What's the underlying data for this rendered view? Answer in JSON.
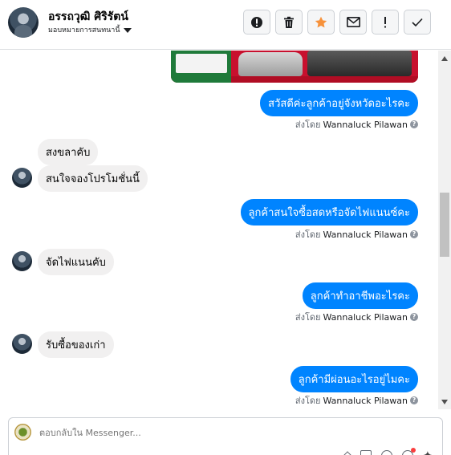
{
  "header": {
    "name": "อรรถวุฒิ ศิริรัตน์",
    "assign_label": "มอบหมายการสนทนานี้",
    "actions": [
      {
        "name": "alert-button",
        "icon": "exclamation-circle-icon"
      },
      {
        "name": "delete-button",
        "icon": "trash-icon"
      },
      {
        "name": "star-button",
        "icon": "star-icon"
      },
      {
        "name": "mark-unread-button",
        "icon": "envelope-icon"
      },
      {
        "name": "spam-button",
        "icon": "exclamation-icon"
      },
      {
        "name": "done-button",
        "icon": "check-icon"
      }
    ],
    "star_color": "#f7923b"
  },
  "messages": {
    "m1": "สวัสดีค่ะลูกค้าอยู่จังหวัดอะไรคะ",
    "m2": "สงขลาคับ",
    "m3": "สนใจจองโปรโมชั่นนี้",
    "m4": "ลูกค้าสนใจซื้อสดหรือจัดไฟแนนซ์คะ",
    "m5": "จัดไฟแนนคับ",
    "m6": "ลูกค้าทำอาชีพอะไรคะ",
    "m7": "รับซื้อของเก่า",
    "m8": "ลูกค้ามีผ่อนอะไรอยู่ไมคะ"
  },
  "sent_by": {
    "prefix": "ส่งโดย",
    "agent": "Wannaluck Pilawan"
  },
  "composer": {
    "placeholder": "ตอบกลับใน Messenger..."
  },
  "colors": {
    "outgoing_bubble": "#0084ff",
    "incoming_bubble": "#f1f0f0"
  }
}
